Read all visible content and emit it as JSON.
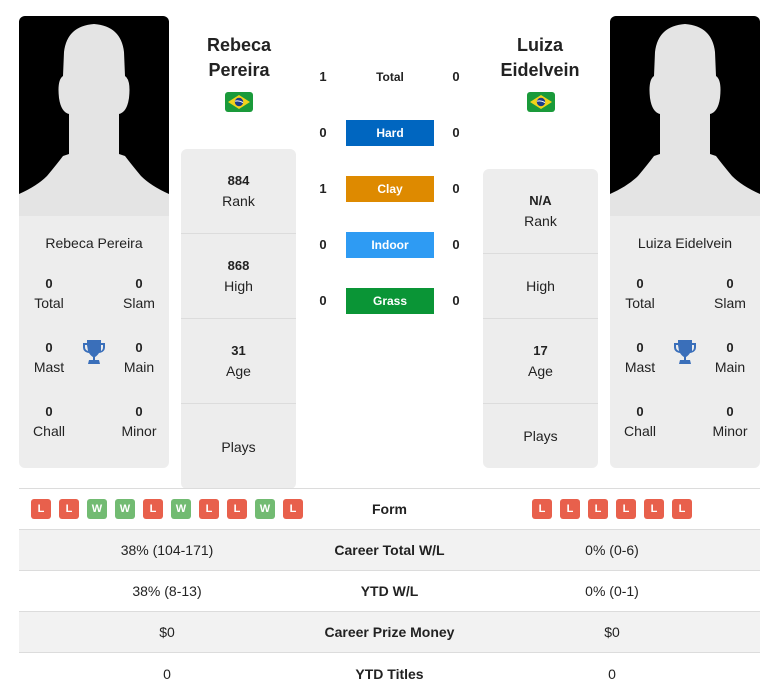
{
  "players": [
    {
      "name_line1": "Rebeca",
      "name_line2": "Pereira",
      "full_name": "Rebeca Pereira",
      "flag": "brazil-flag",
      "titles": {
        "total": {
          "value": "0",
          "label": "Total"
        },
        "slam": {
          "value": "0",
          "label": "Slam"
        },
        "mast": {
          "value": "0",
          "label": "Mast"
        },
        "main": {
          "value": "0",
          "label": "Main"
        },
        "chall": {
          "value": "0",
          "label": "Chall"
        },
        "minor": {
          "value": "0",
          "label": "Minor"
        }
      },
      "stats": [
        {
          "value": "884",
          "label": "Rank"
        },
        {
          "value": "868",
          "label": "High"
        },
        {
          "value": "31",
          "label": "Age"
        },
        {
          "value": "",
          "label": "Plays"
        }
      ],
      "form": [
        "L",
        "L",
        "W",
        "W",
        "L",
        "W",
        "L",
        "L",
        "W",
        "L"
      ]
    },
    {
      "name_line1": "Luiza",
      "name_line2": "Eidelvein",
      "full_name": "Luiza Eidelvein",
      "flag": "brazil-flag",
      "titles": {
        "total": {
          "value": "0",
          "label": "Total"
        },
        "slam": {
          "value": "0",
          "label": "Slam"
        },
        "mast": {
          "value": "0",
          "label": "Mast"
        },
        "main": {
          "value": "0",
          "label": "Main"
        },
        "chall": {
          "value": "0",
          "label": "Chall"
        },
        "minor": {
          "value": "0",
          "label": "Minor"
        }
      },
      "stats": [
        {
          "value": "N/A",
          "label": "Rank"
        },
        {
          "value": "",
          "label": "High"
        },
        {
          "value": "17",
          "label": "Age"
        },
        {
          "value": "",
          "label": "Plays"
        }
      ],
      "form": [
        "L",
        "L",
        "L",
        "L",
        "L",
        "L"
      ]
    }
  ],
  "h2h": [
    {
      "label": "Total",
      "left": "1",
      "right": "0",
      "color": ""
    },
    {
      "label": "Hard",
      "left": "0",
      "right": "0",
      "color": "#0066c0"
    },
    {
      "label": "Clay",
      "left": "1",
      "right": "0",
      "color": "#de8a00"
    },
    {
      "label": "Indoor",
      "left": "0",
      "right": "0",
      "color": "#2e9bf3"
    },
    {
      "label": "Grass",
      "left": "0",
      "right": "0",
      "color": "#0a9536"
    }
  ],
  "table": {
    "form_label": "Form",
    "rows": [
      {
        "label": "Career Total W/L",
        "left": "38% (104-171)",
        "right": "0% (0-6)"
      },
      {
        "label": "YTD W/L",
        "left": "38% (8-13)",
        "right": "0% (0-1)"
      },
      {
        "label": "Career Prize Money",
        "left": "$0",
        "right": "$0"
      },
      {
        "label": "YTD Titles",
        "left": "0",
        "right": "0"
      }
    ]
  },
  "colors": {
    "loss": "#e8604c",
    "win": "#72bb72",
    "trophy": "#3a6fba"
  }
}
